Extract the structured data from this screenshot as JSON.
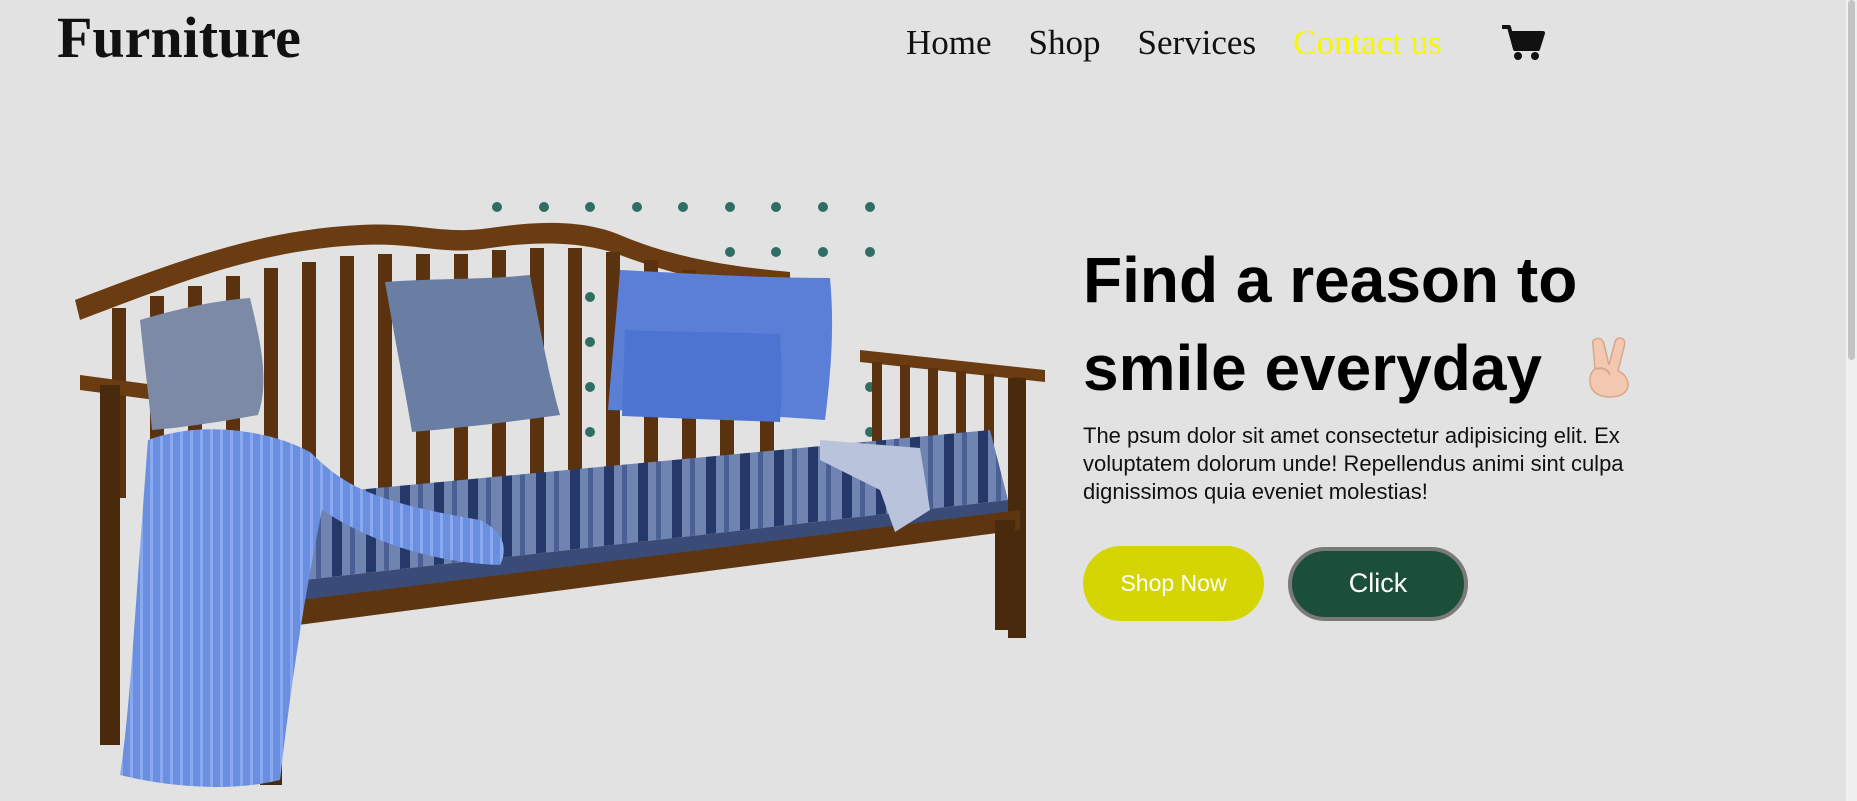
{
  "header": {
    "logo": "Furniture",
    "nav": [
      "Home",
      "Shop",
      "Services",
      "Contact us"
    ],
    "active_nav": "Contact us",
    "cart_icon": "shopping-cart-icon"
  },
  "hero": {
    "headline_line1": "Find a reason to",
    "headline_line2": "smile everyday",
    "emoji_icon": "victory-hand-icon",
    "description": "The psum dolor sit amet consectetur adipisicing elit. Ex voluptatem dolorum unde! Repellendus animi sint culpa dignissimos quia eveniet molestias!",
    "shop_button": "Shop Now",
    "click_button": "Click"
  },
  "colors": {
    "background": "#e2e2e2",
    "active_nav": "#f7f700",
    "shop_button": "#d4d503",
    "click_button": "#1c4f3a",
    "dots": "#2f6f63"
  }
}
